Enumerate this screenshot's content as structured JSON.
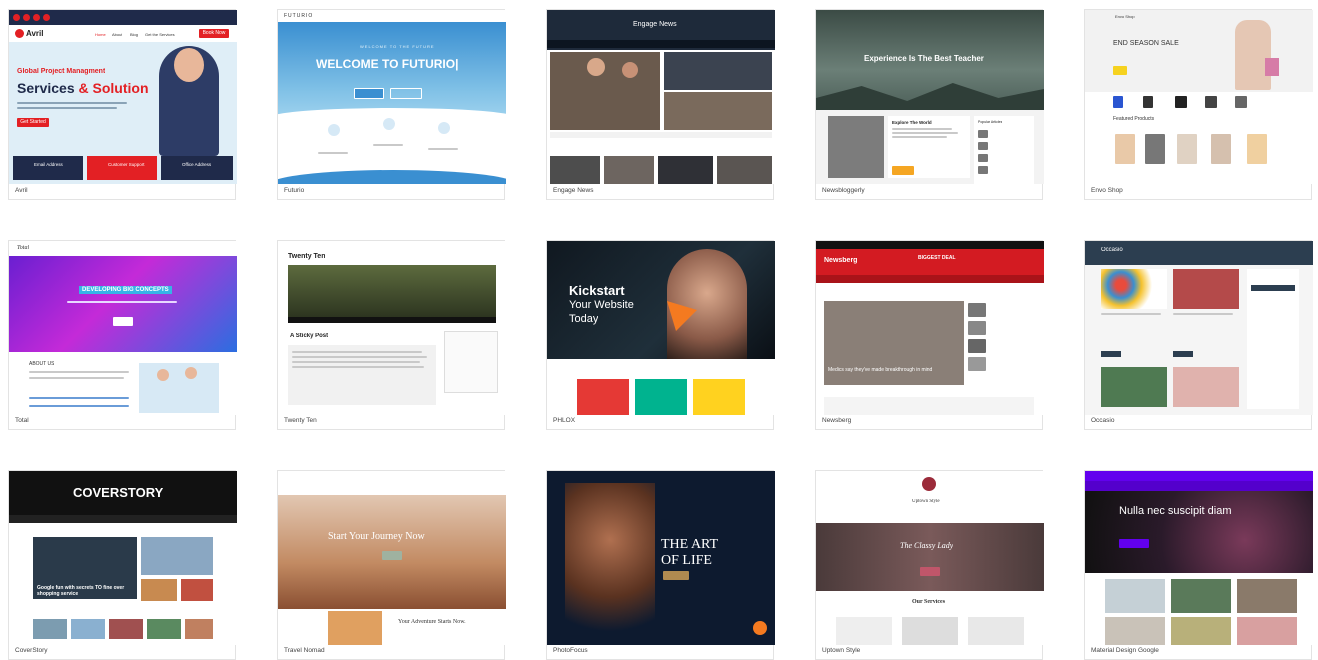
{
  "themes": [
    {
      "name": "Avril",
      "brand": "Avril",
      "nav": [
        "Home",
        "About",
        "Blog",
        "Get the Services"
      ],
      "cta": "Book Now",
      "hero_small": "Global Project Managment",
      "hero_title_a": "Services",
      "hero_amp": "&",
      "hero_title_b": "Solution",
      "hero_btn": "Get Started",
      "boxes": [
        "Email Address",
        "Customer Support",
        "Office Address"
      ]
    },
    {
      "name": "Futurio",
      "brand": "FUTURIO",
      "hero_small": "WELCOME TO THE FUTURE",
      "hero_title": "WELCOME TO FUTURIO|"
    },
    {
      "name": "Engage News",
      "brand": "Engage News"
    },
    {
      "name": "Newsbloggerly",
      "hero_title": "Experience Is The Best Teacher",
      "post_title": "Explore The World",
      "sidebar_title": "Popular Articles"
    },
    {
      "name": "Envo Shop",
      "brand": "Envo Shop",
      "sale": "END SEASON SALE",
      "section": "Featured Products"
    },
    {
      "name": "Total",
      "brand": "Total",
      "hero_title": "DEVELOPING BIG CONCEPTS",
      "about": "ABOUT US"
    },
    {
      "name": "Twenty Ten",
      "brand": "Twenty Ten",
      "post_title": "A Sticky Post"
    },
    {
      "name": "PHLOX",
      "brand": "PHLOX",
      "hero_l1": "Kickstart",
      "hero_l2": "Your Website",
      "hero_l3": "Today"
    },
    {
      "name": "Newsberg",
      "brand": "Newsberg",
      "ad": "BIGGEST DEAL",
      "headline": "Medics say they've made breakthrough in mind"
    },
    {
      "name": "Occasio",
      "brand": "Occasio"
    },
    {
      "name": "CoverStory",
      "brand": "COVERSTORY",
      "headline": "Google fun with secrets TO fine over shopping service"
    },
    {
      "name": "Travel Nomad",
      "hero_title": "Start Your Journey Now",
      "sub": "Your Adventure Starts Now."
    },
    {
      "name": "PhotoFocus",
      "hero_l1": "THE ART",
      "hero_l2": "OF LIFE"
    },
    {
      "name": "Uptown Style",
      "brand": "Uptown Style",
      "hero_title": "The Classy Lady",
      "section": "Our Services"
    },
    {
      "name": "Material Design Google",
      "hero_title": "Nulla nec suscipit diam"
    }
  ],
  "colors": {
    "avril_red": "#e32024",
    "avril_navy": "#1f2a4a",
    "futurio_blue": "#3a8fd1",
    "newsberg_red": "#d31b22",
    "occasio_navy": "#2c3e50",
    "material_purple": "#6200ee",
    "phlox_orange": "#f47a20"
  }
}
